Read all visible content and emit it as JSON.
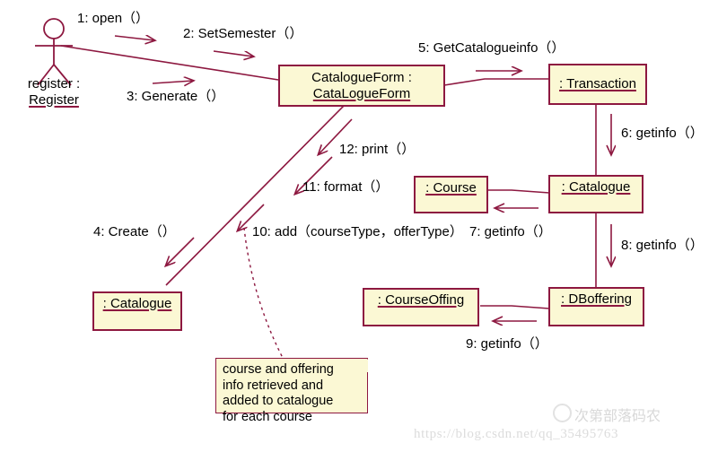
{
  "diagram": {
    "title": "UML Collaboration Diagram",
    "colors": {
      "box_fill": "#fbf8d4",
      "box_border": "#8d1840",
      "line": "#8d1840",
      "text": "#000000",
      "watermark": "#dcdcdc"
    }
  },
  "actor": {
    "name": "actor-register",
    "label_line1": "register :",
    "label_line2": "Register"
  },
  "objects": [
    {
      "id": "catalogueform",
      "line1": "CatalogueForm :",
      "line2": "CataLogueForm",
      "underline": "line2"
    },
    {
      "id": "transaction",
      "line1": ": Transaction",
      "line2": "",
      "underline": "line1"
    },
    {
      "id": "course",
      "line1": ": Course",
      "line2": "",
      "underline": "line1"
    },
    {
      "id": "catalogue-right",
      "line1": ": Catalogue",
      "line2": "",
      "underline": "line1"
    },
    {
      "id": "catalogue-left",
      "line1": ": Catalogue",
      "line2": "",
      "underline": "line1"
    },
    {
      "id": "courseoffing",
      "line1": ": CourseOffing",
      "line2": "",
      "underline": "line1"
    },
    {
      "id": "dboffering",
      "line1": ": DBoffering",
      "line2": "",
      "underline": "line1"
    }
  ],
  "messages": [
    {
      "seq": "1",
      "label": "1: open（）"
    },
    {
      "seq": "2",
      "label": "2: SetSemester（）"
    },
    {
      "seq": "3",
      "label": "3: Generate（）"
    },
    {
      "seq": "4",
      "label": "4: Create（）"
    },
    {
      "seq": "5",
      "label": "5: GetCatalogueinfo（）"
    },
    {
      "seq": "6",
      "label": "6: getinfo（）"
    },
    {
      "seq": "7",
      "label": "7: getinfo（）"
    },
    {
      "seq": "8",
      "label": "8: getinfo（）"
    },
    {
      "seq": "9",
      "label": "9: getinfo（）"
    },
    {
      "seq": "10",
      "label": "10: add（courseType，offerType）"
    },
    {
      "seq": "11",
      "label": "11: format（）"
    },
    {
      "seq": "12",
      "label": "12: print（）"
    }
  ],
  "note": {
    "text": "course and offering\ninfo retrieved and\nadded to catalogue\nfor each course"
  },
  "watermark": {
    "cn_text": "次第部落码农",
    "url_text": "https://blog.csdn.net/qq_35495763"
  }
}
